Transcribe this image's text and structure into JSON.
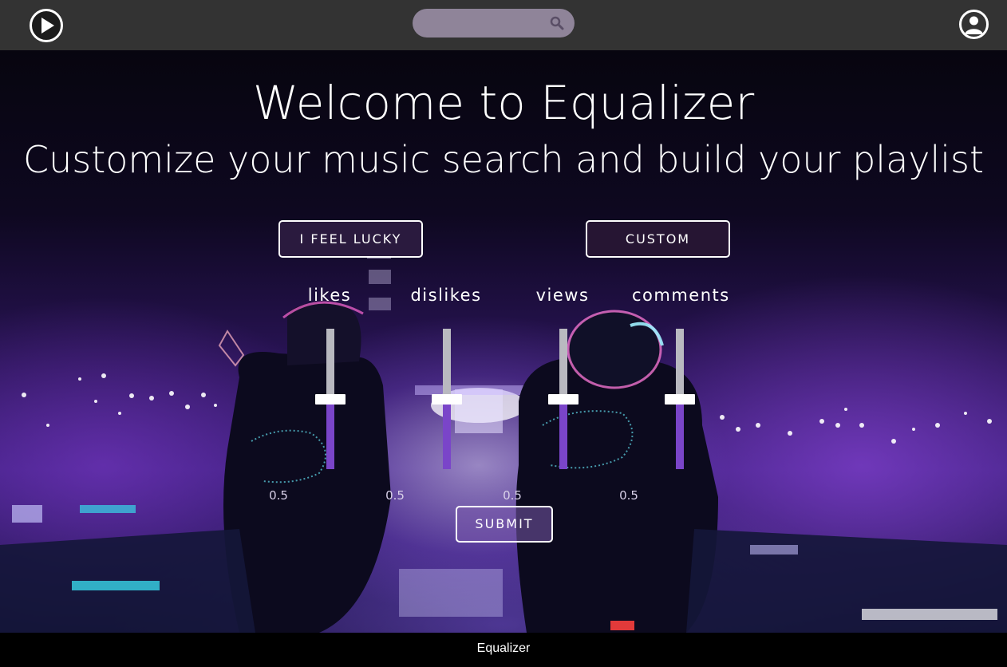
{
  "header": {
    "logo_icon": "play-circle-icon",
    "search": {
      "placeholder": "",
      "icon": "search-icon"
    },
    "account_icon": "user-circle-icon"
  },
  "hero": {
    "title": "Welcome to Equalizer",
    "subtitle": "Customize your music search and build your playlist",
    "buttons": {
      "lucky": "I FEEL LUCKY",
      "custom": "CUSTOM"
    },
    "sliders": [
      {
        "label": "likes",
        "value": "0.5",
        "level": 0.5
      },
      {
        "label": "dislikes",
        "value": "0.5",
        "level": 0.5
      },
      {
        "label": "views",
        "value": "0.5",
        "level": 0.5
      },
      {
        "label": "comments",
        "value": "0.5",
        "level": 0.5
      }
    ],
    "submit": "SUBMIT"
  },
  "footer": {
    "text": "Equalizer"
  },
  "colors": {
    "navbar": "#333333",
    "search_bg": "#8f8499",
    "slider_fill": "#7a45c9",
    "slider_track": "#b9b9c0",
    "footer": "#000000"
  }
}
